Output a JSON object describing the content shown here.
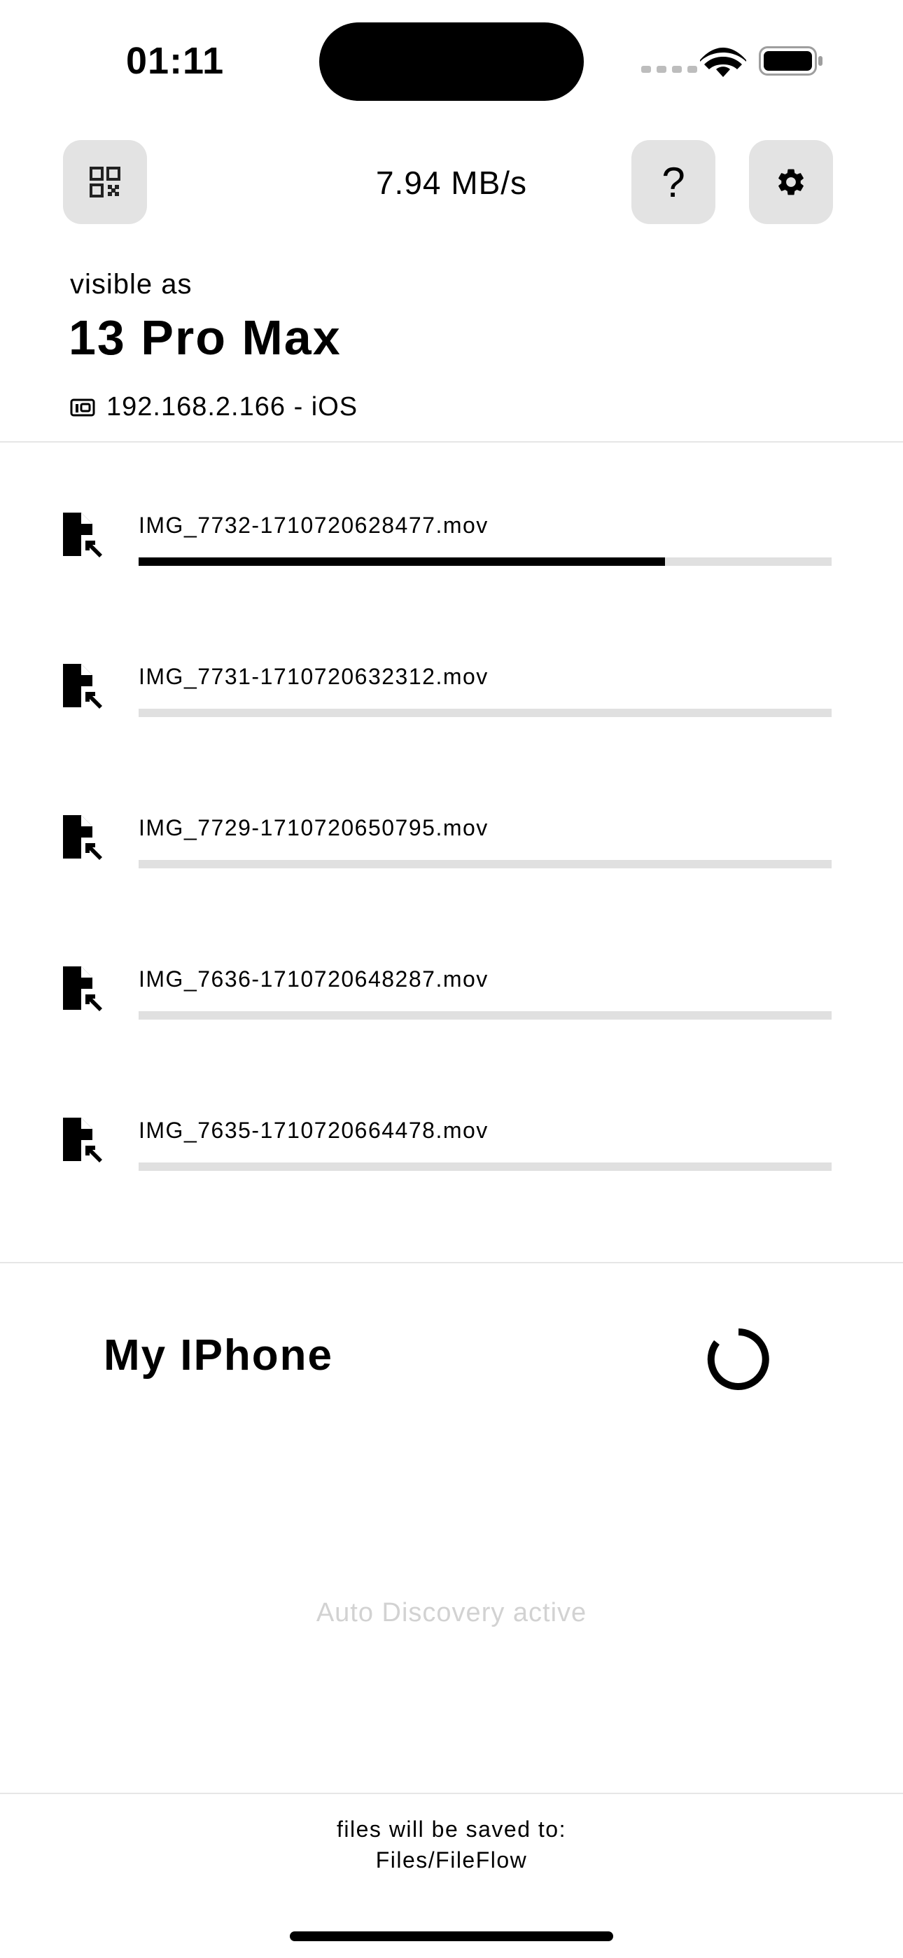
{
  "status_bar": {
    "time": "01:11",
    "icons": [
      "cellular-signal-icon",
      "wifi-icon",
      "battery-icon"
    ]
  },
  "top_bar": {
    "qr_icon": "qr-code-icon",
    "speed": "7.94 MB/s",
    "help_label": "?",
    "settings_icon": "gear-icon"
  },
  "device": {
    "visible_as_label": "visible as",
    "name": "13 Pro Max",
    "ip_line": "192.168.2.166 - iOS",
    "ip_icon": "network-device-icon"
  },
  "transfers": [
    {
      "name": "IMG_7732-1710720628477.mov",
      "progress": 0.76,
      "icon": "file-download-icon"
    },
    {
      "name": "IMG_7731-1710720632312.mov",
      "progress": 0,
      "icon": "file-download-icon"
    },
    {
      "name": "IMG_7729-1710720650795.mov",
      "progress": 0,
      "icon": "file-download-icon"
    },
    {
      "name": "IMG_7636-1710720648287.mov",
      "progress": 0,
      "icon": "file-download-icon"
    },
    {
      "name": "IMG_7635-1710720664478.mov",
      "progress": 0,
      "icon": "file-download-icon"
    }
  ],
  "discovery": {
    "title": "My IPhone",
    "status": "Auto Discovery active",
    "spinner_icon": "loading-spinner-icon"
  },
  "footer": {
    "line1": "files will be saved to:",
    "line2": "Files/FileFlow"
  },
  "colors": {
    "button_bg": "#e3e3e3",
    "progress_track": "#e0e0e0",
    "progress_fill": "#000000",
    "muted_text": "#d2d2d2"
  }
}
